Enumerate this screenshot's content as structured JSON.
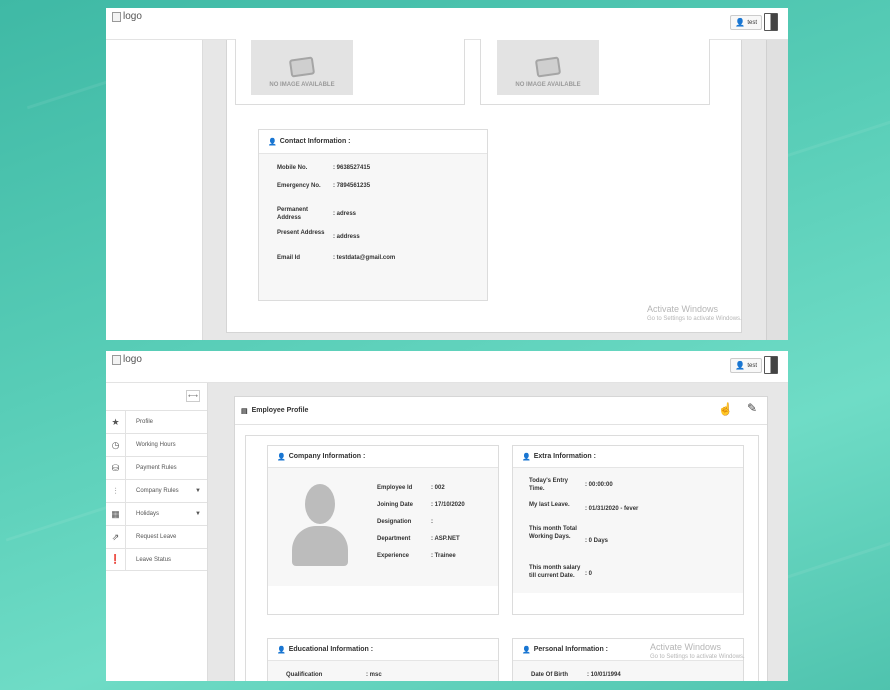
{
  "top": {
    "header": {
      "logo_alt": "logo",
      "user_label": "test"
    },
    "no_image_label": "NO IMAGE AVAILABLE",
    "contact": {
      "title": "Contact Information :",
      "rows": [
        {
          "label": "Mobile No.",
          "value": ": 9638527415"
        },
        {
          "label": "Emergency No.",
          "value": ": 7894561235"
        },
        {
          "label": "Permanent Address",
          "value": ": adress"
        },
        {
          "label": "Present Address",
          "value": ": address"
        },
        {
          "label": "Email Id",
          "value": ": testdata@gmail.com"
        }
      ]
    },
    "watermark": {
      "line1": "Activate Windows",
      "line2": "Go to Settings to activate Windows."
    }
  },
  "bottom": {
    "header": {
      "logo_alt": "logo",
      "user_label": "test"
    },
    "sidebar": {
      "toggle_glyph": "⟷",
      "items": [
        {
          "label": "Profile",
          "icon": "star-icon",
          "glyph": "★"
        },
        {
          "label": "Working Hours",
          "icon": "clock-icon",
          "glyph": "◷"
        },
        {
          "label": "Payment Rules",
          "icon": "money-icon",
          "glyph": "⛁"
        },
        {
          "label": "Company Rules",
          "icon": "sliders-icon",
          "glyph": "⫶",
          "has_caret": true
        },
        {
          "label": "Holidays",
          "icon": "calendar-icon",
          "glyph": "▦",
          "has_caret": true
        },
        {
          "label": "Request Leave",
          "icon": "share-icon",
          "glyph": "⇗"
        },
        {
          "label": "Leave Status",
          "icon": "alert-icon",
          "glyph": "❗"
        }
      ]
    },
    "page_title": "Employee Profile",
    "company": {
      "title": "Company Information :",
      "rows": [
        {
          "label": "Employee Id",
          "value": ": 002"
        },
        {
          "label": "Joining Date",
          "value": ": 17/10/2020"
        },
        {
          "label": "Designation",
          "value": ":"
        },
        {
          "label": "Department",
          "value": ": ASP.NET"
        },
        {
          "label": "Experience",
          "value": ": Trainee"
        }
      ]
    },
    "extra": {
      "title": "Extra Information :",
      "rows": [
        {
          "label": "Today's Entry Time.",
          "value": ": 00:00:00"
        },
        {
          "label": "My last Leave.",
          "value": ": 01/31/2020 - fever"
        },
        {
          "label": "This month Total Working Days.",
          "value": ": 0 Days"
        },
        {
          "label": "This month salary till current Date.",
          "value": ": 0"
        }
      ]
    },
    "education": {
      "title": "Educational Information :",
      "rows": [
        {
          "label": "Qualification",
          "value": ": msc"
        }
      ]
    },
    "personal": {
      "title": "Personal Information :",
      "rows": [
        {
          "label": "Date Of Birth",
          "value": ": 10/01/1994"
        }
      ]
    },
    "watermark": {
      "line1": "Activate Windows",
      "line2": "Go to Settings to activate Windows."
    }
  }
}
